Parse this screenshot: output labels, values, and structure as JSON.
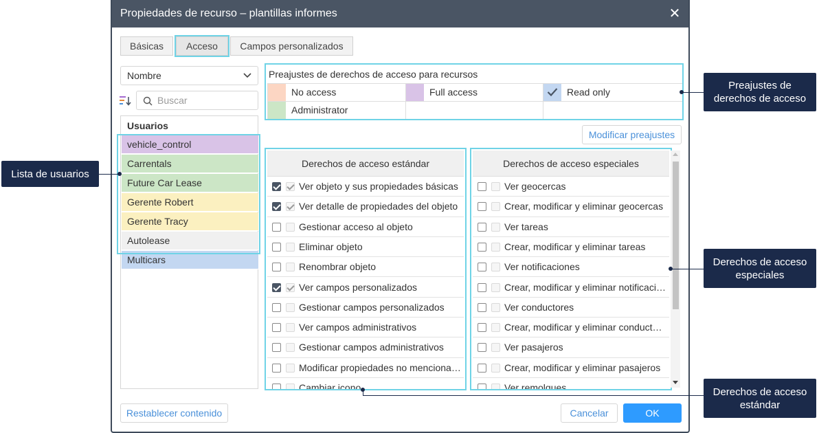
{
  "dialog": {
    "title": "Propiedades de recurso – plantillas informes",
    "close": "✕"
  },
  "tabs": [
    {
      "label": "Básicas"
    },
    {
      "label": "Acceso"
    },
    {
      "label": "Campos personalizados"
    }
  ],
  "sort": {
    "selected": "Nombre"
  },
  "search": {
    "placeholder": "Buscar"
  },
  "users": {
    "header": "Usuarios",
    "items": [
      {
        "label": "vehicle_control",
        "color": "#d9c3e7"
      },
      {
        "label": "Carrentals",
        "color": "#cce6c6"
      },
      {
        "label": "Future Car Lease",
        "color": "#cce6c6"
      },
      {
        "label": "Gerente Robert",
        "color": "#fbf0c0"
      },
      {
        "label": "Gerente Tracy",
        "color": "#fbf0c0"
      },
      {
        "label": "Autolease",
        "color": "#f0f0f0"
      },
      {
        "label": "Multicars",
        "color": "#c3d7f1"
      }
    ]
  },
  "presets": {
    "title": "Preajustes de derechos de acceso para recursos",
    "items": [
      {
        "label": "No access",
        "color": "#fcd6c3"
      },
      {
        "label": "Full access",
        "color": "#d9c3e7"
      },
      {
        "label": "Read only",
        "color": "#c3d7f1"
      },
      {
        "label": "Administrator",
        "color": "#cce6c6"
      }
    ],
    "modify_button": "Modificar preajustes"
  },
  "standard_rights": {
    "header": "Derechos de acceso estándar",
    "rows": [
      {
        "label": "Ver objeto y sus propiedades básicas",
        "checked": true
      },
      {
        "label": "Ver detalle de propiedades del objeto",
        "checked": true
      },
      {
        "label": "Gestionar acceso al objeto",
        "checked": false
      },
      {
        "label": "Eliminar objeto",
        "checked": false
      },
      {
        "label": "Renombrar objeto",
        "checked": false
      },
      {
        "label": "Ver campos personalizados",
        "checked": true
      },
      {
        "label": "Gestionar campos personalizados",
        "checked": false
      },
      {
        "label": "Ver campos administrativos",
        "checked": false
      },
      {
        "label": "Gestionar campos administrativos",
        "checked": false
      },
      {
        "label": "Modificar propiedades no mencionadas",
        "checked": false
      },
      {
        "label": "Cambiar icono",
        "checked": false
      }
    ]
  },
  "special_rights": {
    "header": "Derechos de acceso especiales",
    "rows": [
      {
        "label": "Ver geocercas",
        "checked": false
      },
      {
        "label": "Crear, modificar y eliminar geocercas",
        "checked": false
      },
      {
        "label": "Ver tareas",
        "checked": false
      },
      {
        "label": "Crear, modificar y eliminar tareas",
        "checked": false
      },
      {
        "label": "Ver notificaciones",
        "checked": false
      },
      {
        "label": "Crear, modificar y eliminar notificaciones",
        "checked": false
      },
      {
        "label": "Ver conductores",
        "checked": false
      },
      {
        "label": "Crear, modificar y eliminar conductores",
        "checked": false
      },
      {
        "label": "Ver pasajeros",
        "checked": false
      },
      {
        "label": "Crear, modificar y eliminar pasajeros",
        "checked": false
      },
      {
        "label": "Ver remolques",
        "checked": false
      }
    ]
  },
  "footer": {
    "reset": "Restablecer contenido",
    "cancel": "Cancelar",
    "ok": "OK"
  },
  "callouts": {
    "users_list": "Lista de usuarios",
    "presets": "Preajustes de derechos de acceso",
    "special": "Derechos de acceso especiales",
    "standard": "Derechos de acceso estándar"
  }
}
